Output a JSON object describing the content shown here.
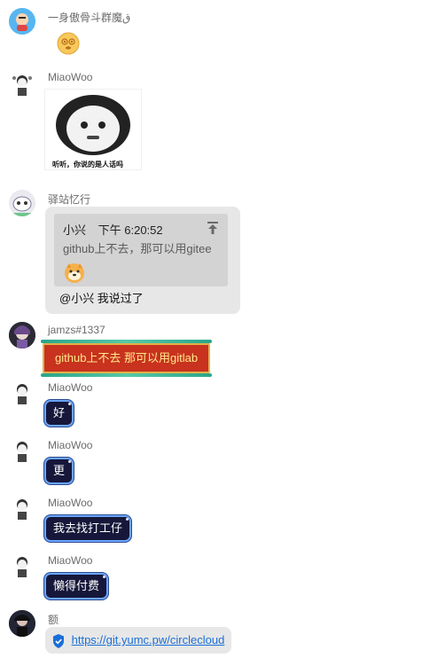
{
  "messages": [
    {
      "name": "一身傲骨斗群魔ق",
      "type": "emoji",
      "emoji": "dizzy-face-icon"
    },
    {
      "name": "MiaoWoo",
      "type": "sticker",
      "caption": "听听，你说的是人话吗"
    },
    {
      "name": "驿站忆行",
      "type": "reply",
      "quote": {
        "author": "小兴",
        "time": "下午 6:20:52",
        "text": "github上不去，那可以用gitee",
        "emoji": "dog-face-icon"
      },
      "text": "@小兴  我说过了"
    },
    {
      "name": "jamzs#1337",
      "type": "text",
      "text": "github上不去 那可以用gitlab"
    },
    {
      "name": "MiaoWoo",
      "type": "text",
      "text": "好"
    },
    {
      "name": "MiaoWoo",
      "type": "text",
      "text": "更"
    },
    {
      "name": "MiaoWoo",
      "type": "text",
      "text": "我去找打工仔"
    },
    {
      "name": "MiaoWoo",
      "type": "text",
      "text": "懒得付费"
    },
    {
      "name": "额",
      "type": "link",
      "text": "https://git.yumc.pw/circlecloud"
    }
  ]
}
